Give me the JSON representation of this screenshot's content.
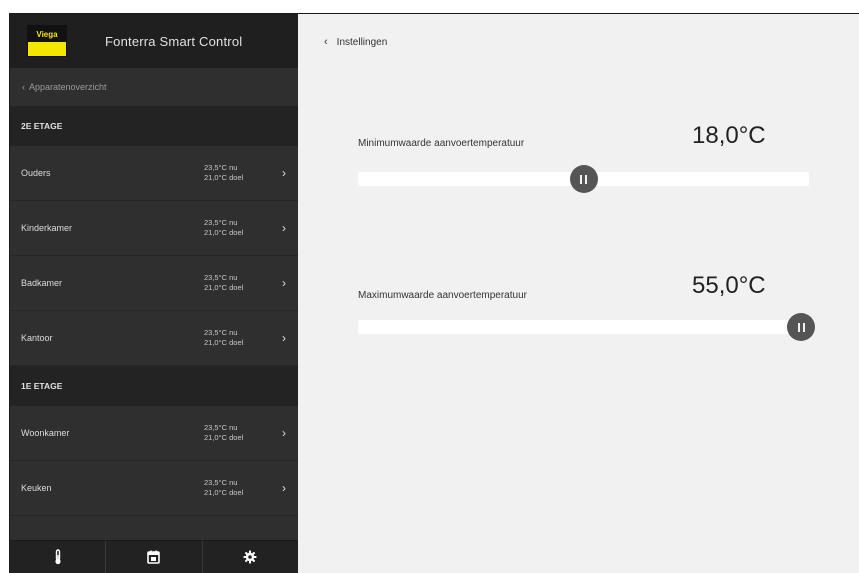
{
  "header": {
    "logo_text": "Viega",
    "app_title": "Fonterra Smart Control"
  },
  "sidebar": {
    "back_label": "Apparatenoverzicht",
    "sections": [
      {
        "title": "2E ETAGE",
        "rooms": [
          {
            "name": "Ouders",
            "current": "23,5°C nu",
            "target": "21,0°C doel"
          },
          {
            "name": "Kinderkamer",
            "current": "23,5°C nu",
            "target": "21,0°C doel"
          },
          {
            "name": "Badkamer",
            "current": "23,5°C nu",
            "target": "21,0°C doel"
          },
          {
            "name": "Kantoor",
            "current": "23,5°C nu",
            "target": "21,0°C doel"
          }
        ]
      },
      {
        "title": "1E ETAGE",
        "rooms": [
          {
            "name": "Woonkamer",
            "current": "23,5°C nu",
            "target": "21,0°C doel"
          },
          {
            "name": "Keuken",
            "current": "23,5°C nu",
            "target": "21,0°C doel"
          }
        ]
      }
    ],
    "tabs": [
      {
        "icon": "thermometer-icon"
      },
      {
        "icon": "calendar-icon"
      },
      {
        "icon": "gear-icon"
      }
    ]
  },
  "main": {
    "back_label": "Instellingen",
    "settings": [
      {
        "label": "Minimumwaarde aanvoertemperatuur",
        "value": "18,0°C",
        "slider_fraction": 0.5
      },
      {
        "label": "Maximumwaarde aanvoertemperatuur",
        "value": "55,0°C",
        "slider_fraction": 1.0
      }
    ]
  },
  "colors": {
    "brand_yellow": "#f5e600",
    "sidebar_bg": "#2f2f2f",
    "main_bg": "#f1f1f1",
    "thumb": "#555555"
  }
}
